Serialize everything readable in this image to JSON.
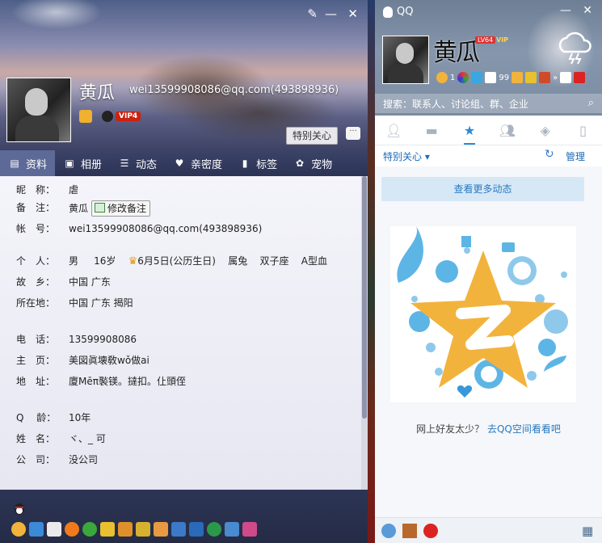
{
  "profile": {
    "nickname": "黄瓜",
    "email_header": "wei13599908086@qq.com(493898936)",
    "special_care_button": "特别关心",
    "vip_badge": "VIP4",
    "tabs": [
      {
        "label": "资料",
        "icon": "profile-card-icon"
      },
      {
        "label": "相册",
        "icon": "album-icon"
      },
      {
        "label": "动态",
        "icon": "feed-list-icon"
      },
      {
        "label": "亲密度",
        "icon": "heart-icon"
      },
      {
        "label": "标签",
        "icon": "bookmark-icon"
      },
      {
        "label": "宠物",
        "icon": "pet-icon"
      }
    ],
    "fields": {
      "nick_label": "昵　称：",
      "nick_value": "虐",
      "remark_label": "备　注：",
      "remark_value": "黄瓜",
      "remark_button": "修改备注",
      "account_label": "帐　号：",
      "account_value": "wei13599908086@qq.com(493898936)",
      "personal_label": "个　人：",
      "gender": "男",
      "age": "16岁",
      "birthday": "6月5日(公历生日)",
      "zodiac": "属兔",
      "star_sign": "双子座",
      "blood_type": "A型血",
      "hometown_label": "故　乡：",
      "hometown_value": "中国 广东",
      "location_label": "所在地：",
      "location_value": "中国 广东 揭阳",
      "phone_label": "电　话：",
      "phone_value": "13599908086",
      "homepage_label": "主　页：",
      "homepage_value": "美図眞壊敎wǒ做ai",
      "address_label": "地　址：",
      "address_value": "廈Mēπ褧镁。撻扣。仩頭侄",
      "qage_label": "Q　 龄：",
      "qage_value": "10年",
      "name_label": "姓　名：",
      "name_value": "ヾ、_ 可",
      "company_label": "公　司：",
      "company_value": "没公司"
    }
  },
  "qq": {
    "app_title": "QQ",
    "nickname_art": "黄瓜",
    "level_tag": "LV64",
    "vip_tag": "VIP",
    "mail_count": "99",
    "star_count": "1",
    "search_placeholder": "搜索：联系人、讨论组、群、企业",
    "special_care_dropdown": "特别关心",
    "manage_link": "管理",
    "more_feeds_button": "查看更多动态",
    "empty_text": "网上好友太少？",
    "qzone_link": "去QQ空间看看吧",
    "tabs": [
      "contacts",
      "messages",
      "qzone",
      "groups",
      "apps",
      "phone"
    ],
    "active_tab": "qzone"
  },
  "colors": {
    "accent": "#2a8ad8",
    "star_gold": "#f2b33d",
    "bubble_blue": "#5db5e6",
    "vip_red": "#cc2211"
  }
}
